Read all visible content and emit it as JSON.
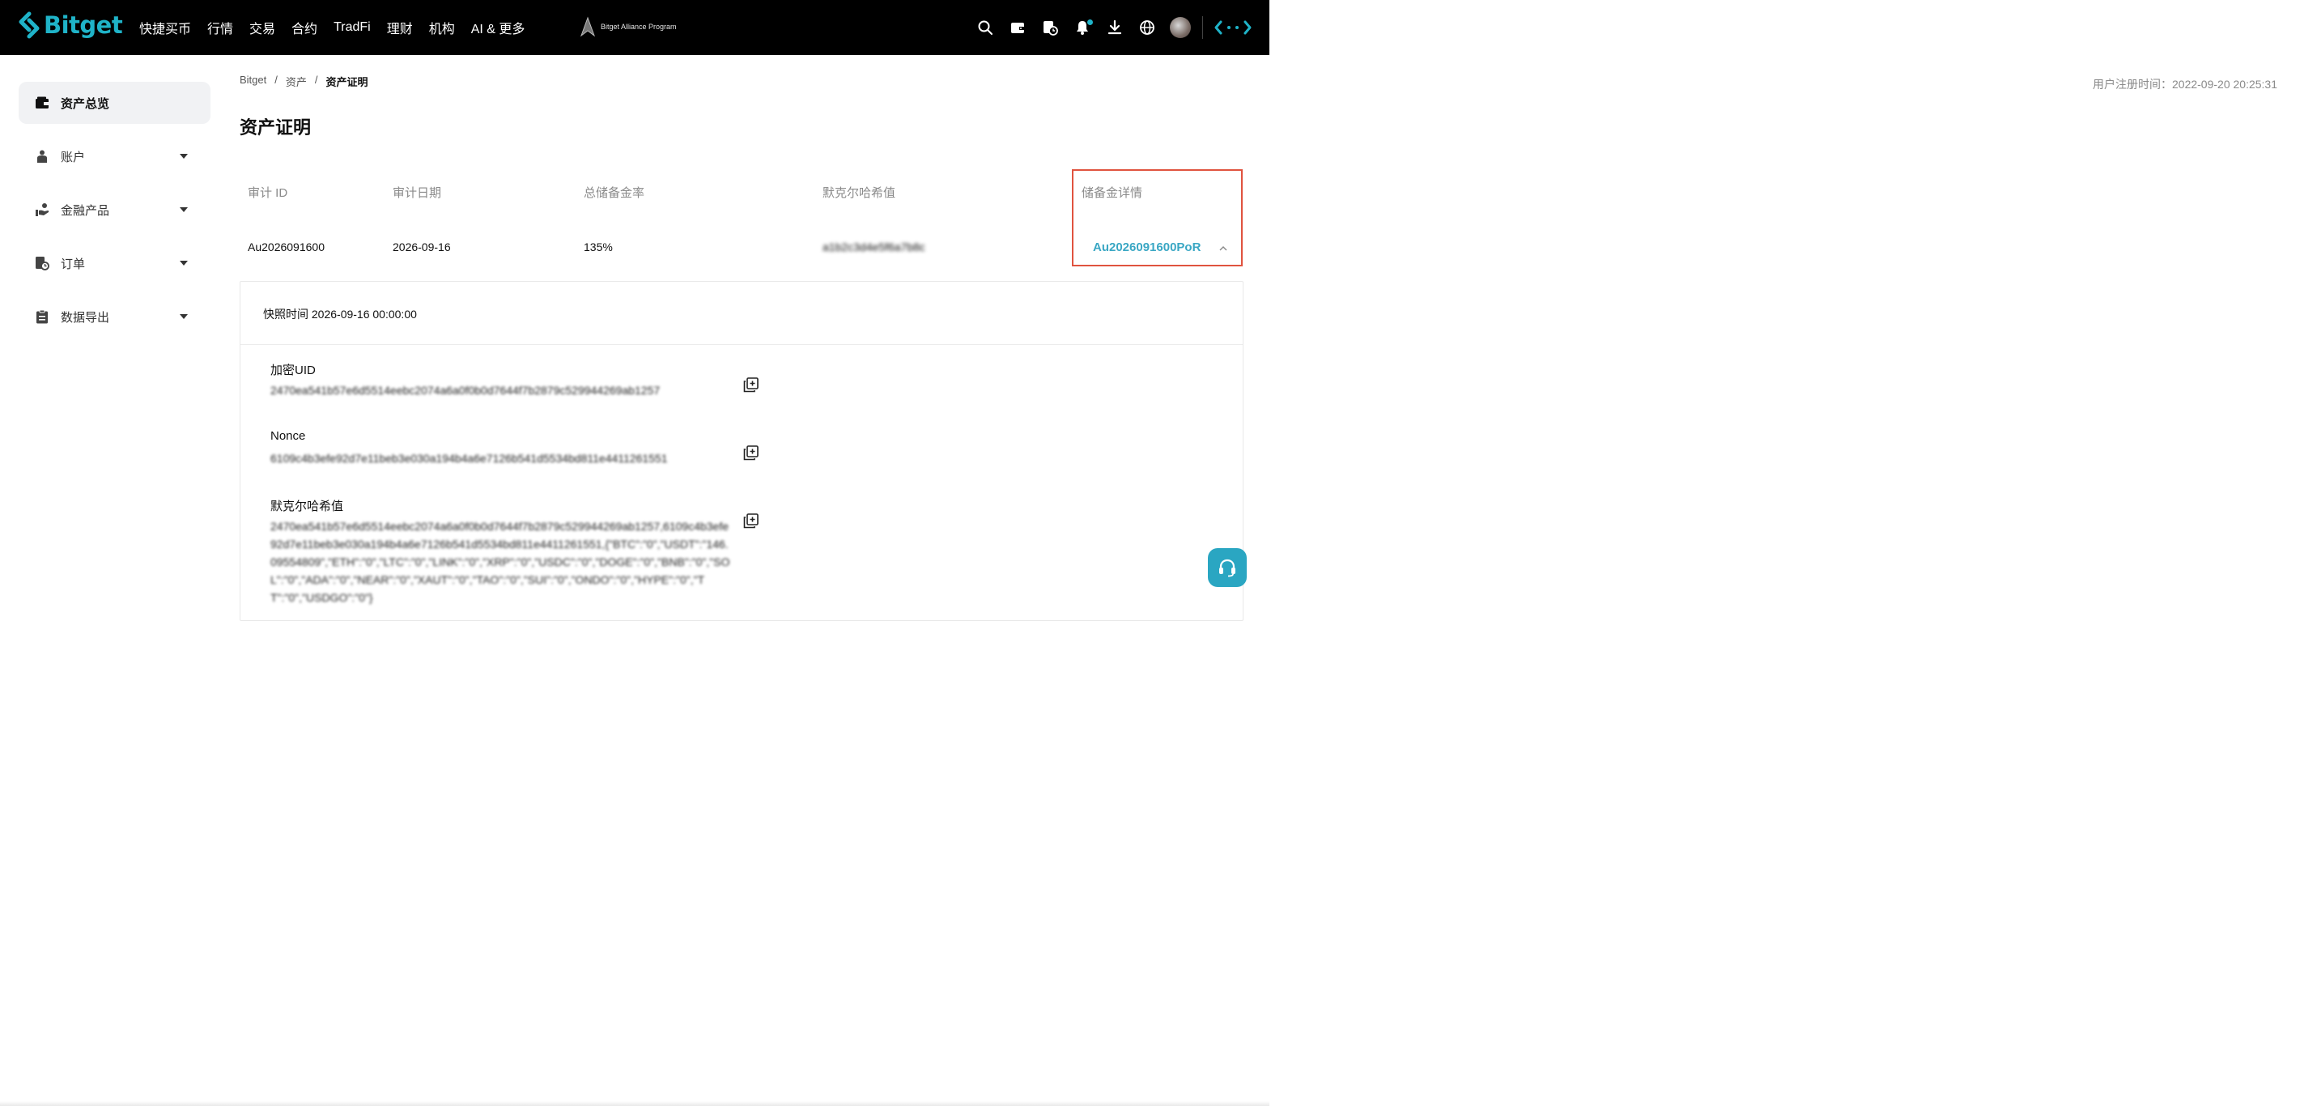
{
  "brand": {
    "name": "Bitget",
    "accent": "#1fb3c8"
  },
  "nav": {
    "items": [
      "快捷买币",
      "行情",
      "交易",
      "合约",
      "TradFi",
      "理财",
      "机构",
      "AI & 更多"
    ],
    "alliance_label": "Bitget Alliance Program"
  },
  "top_icons": [
    "search-icon",
    "wallet-icon",
    "history-icon",
    "bell-icon",
    "download-icon",
    "globe-icon",
    "avatar",
    "brand-mark-icon"
  ],
  "sidebar": {
    "items": [
      {
        "label": "资产总览",
        "icon": "wallet-icon",
        "active": true
      },
      {
        "label": "账户",
        "icon": "user-icon",
        "expandable": true
      },
      {
        "label": "金融产品",
        "icon": "finance-icon",
        "expandable": true
      },
      {
        "label": "订单",
        "icon": "order-icon",
        "expandable": true
      },
      {
        "label": "数据导出",
        "icon": "clipboard-icon",
        "expandable": true
      }
    ]
  },
  "breadcrumb": {
    "items": [
      "Bitget",
      "/",
      "资产",
      "/",
      "资产证明"
    ]
  },
  "registration": {
    "text": "用户注册时间：2022-09-20 20:25:31"
  },
  "page": {
    "title": "资产证明"
  },
  "audit_table": {
    "headers": [
      "审计 ID",
      "审计日期",
      "总储备金率",
      "默克尔哈希值",
      "储备金详情"
    ],
    "row": {
      "audit_id": "Au2026091600",
      "date": "2026-09-16",
      "reserve_ratio": "135%",
      "merkle_hash": "a1b2c3d4e5f6a7b8c9d0",
      "reserve_link": "Au2026091600PoR"
    }
  },
  "details": {
    "snapshot": "快照时间 2026-09-16 00:00:00",
    "uid_label": "加密UID",
    "uid_value": "2470ea541b57e6d5514eebc2074a6a0f0b0d7644f7b2879c529944269ab1257",
    "nonce_label": "Nonce",
    "nonce_value": "6109c4b3efe92d7e11beb3e030a194b4a6e7126b541d5534bd811e4411261551",
    "merkle_label": "默克尔哈希值",
    "merkle_value": "2470ea541b57e6d5514eebc2074a6a0f0b0d7644f7b2879c529944269ab1257,6109c4b3efe92d7e11beb3e030a194b4a6e7126b541d5534bd811e4411261551,{\"BTC\":\"0\",\"USDT\":\"146.09554809\",\"ETH\":\"0\",\"LTC\":\"0\",\"LINK\":\"0\",\"XRP\":\"0\",\"USDC\":\"0\",\"DOGE\":\"0\",\"BNB\":\"0\",\"SOL\":\"0\",\"ADA\":\"0\",\"NEAR\":\"0\",\"XAUT\":\"0\",\"TAO\":\"0\",\"SUI\":\"0\",\"ONDO\":\"0\",\"HYPE\":\"0\",\"TT\":\"0\",\"USDGO\":\"0\"}"
  },
  "colors": {
    "link": "#3aa7c4",
    "highlight": "#e0533f",
    "help_button": "#2aa6c2"
  }
}
